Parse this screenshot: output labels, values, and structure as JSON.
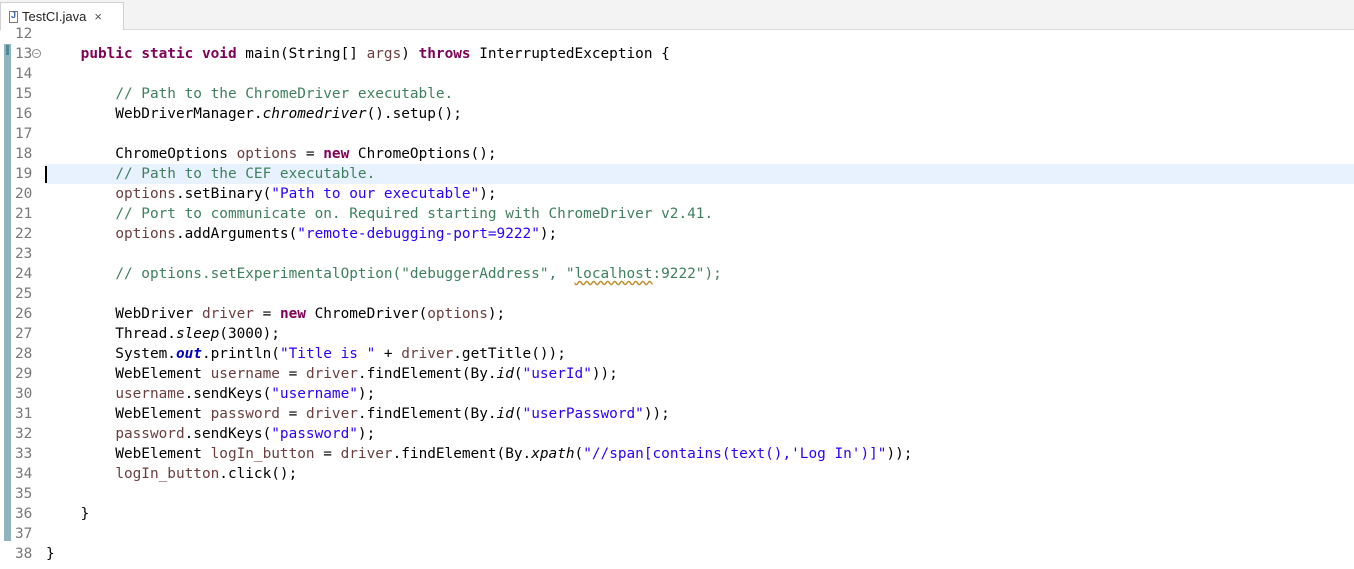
{
  "tab": {
    "filename": "TestCI.java",
    "close_symbol": "×"
  },
  "editor": {
    "current_line": 19,
    "lines": [
      {
        "num": "12",
        "text": ""
      },
      {
        "num": "13",
        "text": "    public static void main(String[] args) throws InterruptedException {",
        "fold": "⊖"
      },
      {
        "num": "14",
        "text": ""
      },
      {
        "num": "15",
        "text": "        // Path to the ChromeDriver executable."
      },
      {
        "num": "16",
        "text": "        WebDriverManager.chromedriver().setup();"
      },
      {
        "num": "17",
        "text": ""
      },
      {
        "num": "18",
        "text": "        ChromeOptions options = new ChromeOptions();"
      },
      {
        "num": "19",
        "text": "        // Path to the CEF executable."
      },
      {
        "num": "20",
        "text": "        options.setBinary(\"Path to our executable\");"
      },
      {
        "num": "21",
        "text": "        // Port to communicate on. Required starting with ChromeDriver v2.41."
      },
      {
        "num": "22",
        "text": "        options.addArguments(\"remote-debugging-port=9222\");"
      },
      {
        "num": "23",
        "text": ""
      },
      {
        "num": "24",
        "text": "        // options.setExperimentalOption(\"debuggerAddress\", \"localhost:9222\");"
      },
      {
        "num": "25",
        "text": ""
      },
      {
        "num": "26",
        "text": "        WebDriver driver = new ChromeDriver(options);"
      },
      {
        "num": "27",
        "text": "        Thread.sleep(3000);"
      },
      {
        "num": "28",
        "text": "        System.out.println(\"Title is \" + driver.getTitle());"
      },
      {
        "num": "29",
        "text": "        WebElement username = driver.findElement(By.id(\"userId\"));"
      },
      {
        "num": "30",
        "text": "        username.sendKeys(\"username\");"
      },
      {
        "num": "31",
        "text": "        WebElement password = driver.findElement(By.id(\"userPassword\"));"
      },
      {
        "num": "32",
        "text": "        password.sendKeys(\"password\");"
      },
      {
        "num": "33",
        "text": "        WebElement logIn_button = driver.findElement(By.xpath(\"//span[contains(text(),'Log In')]\"));"
      },
      {
        "num": "34",
        "text": "        logIn_button.click();"
      },
      {
        "num": "35",
        "text": ""
      },
      {
        "num": "36",
        "text": "    }"
      },
      {
        "num": "37",
        "text": ""
      },
      {
        "num": "38",
        "text": "}"
      }
    ]
  }
}
